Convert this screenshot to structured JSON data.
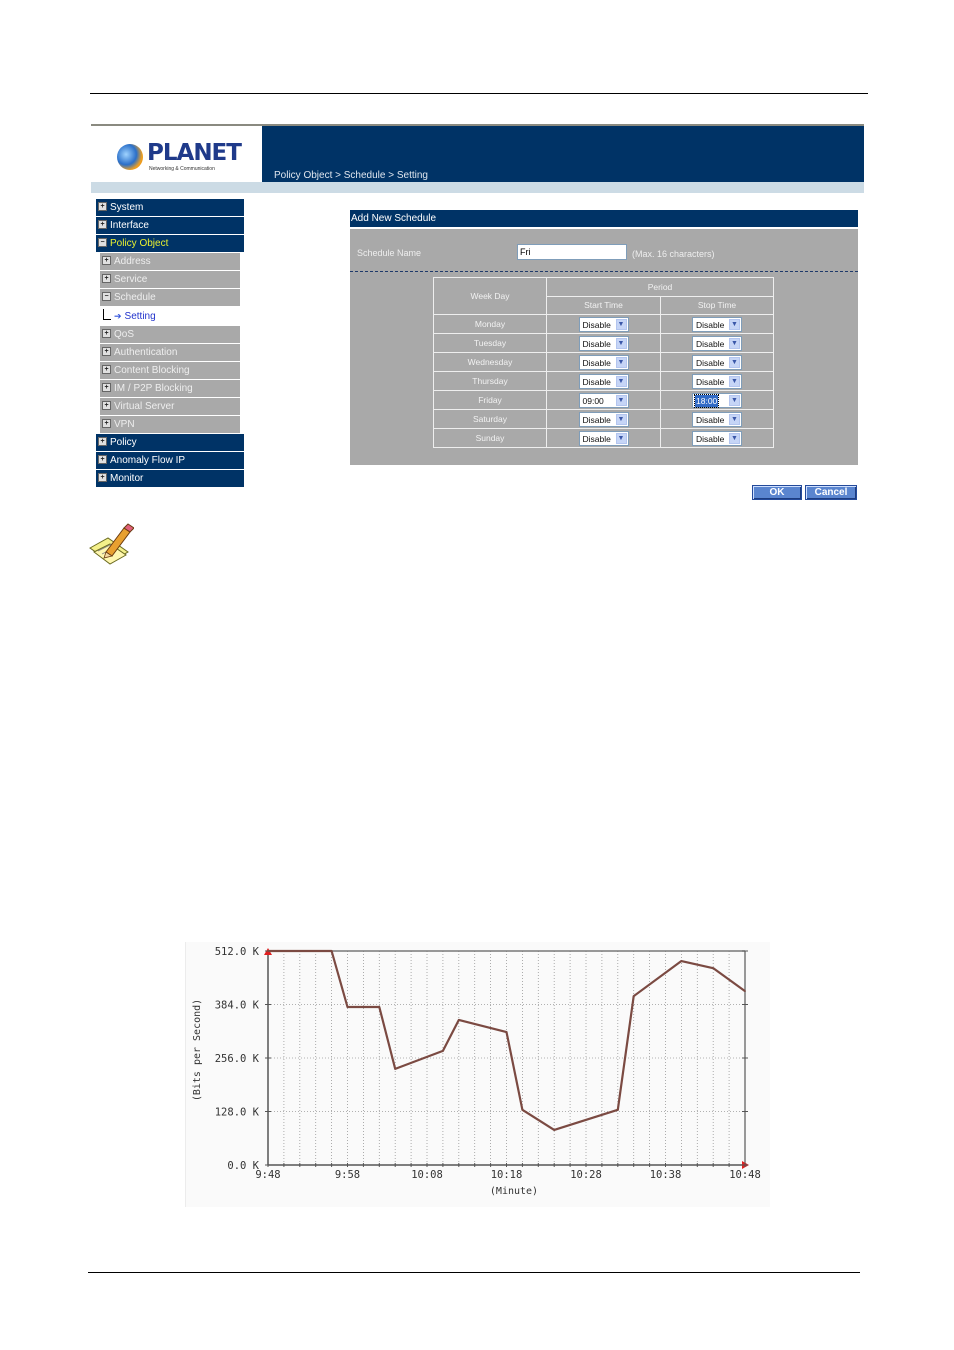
{
  "header": {
    "logo_text": "PLANET",
    "logo_subtitle": "Networking & Communication",
    "breadcrumb": "Policy Object > Schedule > Setting"
  },
  "sidebar": {
    "items": [
      {
        "label": "System",
        "level": "top",
        "state": "collapsed"
      },
      {
        "label": "Interface",
        "level": "top",
        "state": "collapsed"
      },
      {
        "label": "Policy Object",
        "level": "top",
        "state": "expanded",
        "active": true
      },
      {
        "label": "Address",
        "level": "sub",
        "state": "collapsed"
      },
      {
        "label": "Service",
        "level": "sub",
        "state": "collapsed"
      },
      {
        "label": "Schedule",
        "level": "sub",
        "state": "expanded"
      },
      {
        "label": "Setting",
        "level": "leaf",
        "selected": true
      },
      {
        "label": "QoS",
        "level": "sub",
        "state": "collapsed"
      },
      {
        "label": "Authentication",
        "level": "sub",
        "state": "collapsed"
      },
      {
        "label": "Content Blocking",
        "level": "sub",
        "state": "collapsed"
      },
      {
        "label": "IM / P2P Blocking",
        "level": "sub",
        "state": "collapsed"
      },
      {
        "label": "Virtual Server",
        "level": "sub",
        "state": "collapsed"
      },
      {
        "label": "VPN",
        "level": "sub",
        "state": "collapsed"
      },
      {
        "label": "Policy",
        "level": "top",
        "state": "collapsed"
      },
      {
        "label": "Anomaly Flow IP",
        "level": "top",
        "state": "collapsed"
      },
      {
        "label": "Monitor",
        "level": "top",
        "state": "collapsed"
      }
    ]
  },
  "form": {
    "title": "Add New Schedule",
    "schedule_name_label": "Schedule Name",
    "schedule_name_value": "Fri",
    "schedule_name_hint": "(Max. 16 characters)",
    "table": {
      "col_weekday": "Week Day",
      "col_period": "Period",
      "col_start": "Start Time",
      "col_stop": "Stop Time",
      "rows": [
        {
          "day": "Monday",
          "start": "Disable",
          "stop": "Disable"
        },
        {
          "day": "Tuesday",
          "start": "Disable",
          "stop": "Disable"
        },
        {
          "day": "Wednesday",
          "start": "Disable",
          "stop": "Disable"
        },
        {
          "day": "Thursday",
          "start": "Disable",
          "stop": "Disable"
        },
        {
          "day": "Friday",
          "start": "09:00",
          "stop": "18:00"
        },
        {
          "day": "Saturday",
          "start": "Disable",
          "stop": "Disable"
        },
        {
          "day": "Sunday",
          "start": "Disable",
          "stop": "Disable"
        }
      ]
    },
    "ok_label": "OK",
    "cancel_label": "Cancel"
  },
  "colors": {
    "nav_dark": "#003366",
    "nav_sub": "#a9a9a9",
    "active_text": "#e8f030",
    "line": "#7b4a42"
  },
  "chart_data": {
    "type": "line",
    "title": "",
    "xlabel": "(Minute)",
    "ylabel": "(Bits per Second)",
    "x_ticks": [
      "9:48",
      "9:58",
      "10:08",
      "10:18",
      "10:28",
      "10:38",
      "10:48"
    ],
    "y_ticks": [
      "0.0 K",
      "128.0 K",
      "256.0 K",
      "384.0 K",
      "512.0 K"
    ],
    "ylim": [
      0,
      512
    ],
    "xlim_minutes": [
      0,
      60
    ],
    "grid": true,
    "series": [
      {
        "name": "Bits per Second (K)",
        "x_minutes_after_9_48": [
          0,
          8,
          10,
          14,
          16,
          22,
          24,
          30,
          32,
          36,
          44,
          46,
          52,
          56,
          60
        ],
        "x": [
          "9:48",
          "9:56",
          "9:58",
          "10:02",
          "10:04",
          "10:10",
          "10:12",
          "10:18",
          "10:20",
          "10:24",
          "10:32",
          "10:34",
          "10:40",
          "10:44",
          "10:48"
        ],
        "values": [
          512,
          512,
          378,
          378,
          230,
          273,
          347,
          318,
          132,
          84,
          132,
          404,
          488,
          471,
          416
        ]
      }
    ]
  }
}
